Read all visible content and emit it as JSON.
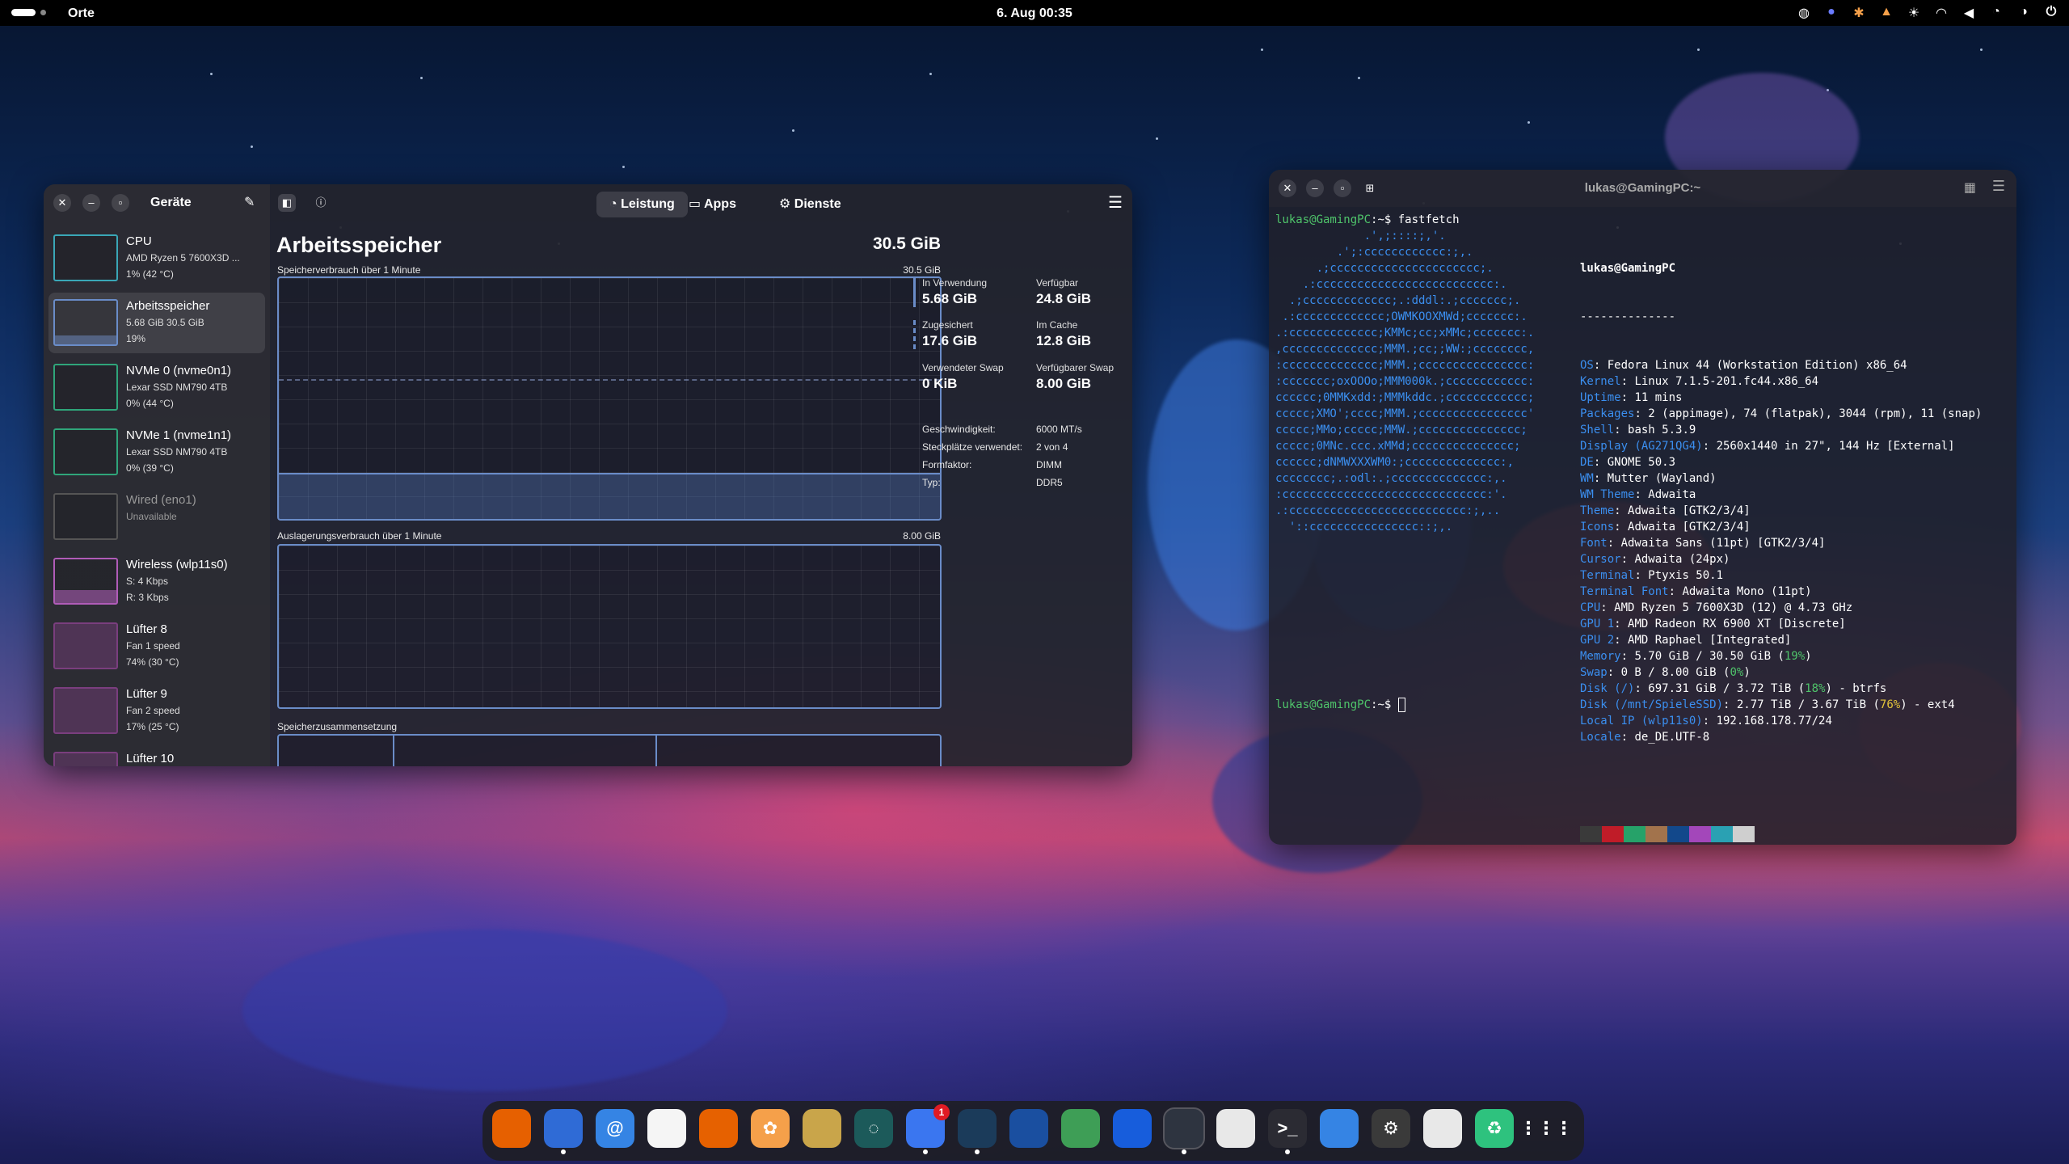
{
  "topbar": {
    "places_label": "Orte",
    "clock": "6. Aug  00:35",
    "tray_icons": [
      "steam-icon",
      "discord-icon",
      "star-icon",
      "update-icon",
      "brightness-icon",
      "wifi-icon",
      "volume-icon",
      "power-profile-icon",
      "battery-icon",
      "power-icon"
    ]
  },
  "resources": {
    "sidebar_title": "Geräte",
    "devices": [
      {
        "name": "CPU",
        "line1": "AMD Ryzen 5 7600X3D ...",
        "line2": "1% (42 °C)",
        "selected": false,
        "dim": false
      },
      {
        "name": "Arbeitsspeicher",
        "line1": "5.68 GiB 30.5 GiB",
        "line2": "19%",
        "selected": true,
        "dim": false
      },
      {
        "name": "NVMe 0 (nvme0n1)",
        "line1": "Lexar SSD NM790 4TB",
        "line2": "0% (44 °C)",
        "selected": false,
        "dim": false
      },
      {
        "name": "NVMe 1 (nvme1n1)",
        "line1": "Lexar SSD NM790 4TB",
        "line2": "0% (39 °C)",
        "selected": false,
        "dim": false
      },
      {
        "name": "Wired (eno1)",
        "line1": "Unavailable",
        "line2": "",
        "selected": false,
        "dim": true
      },
      {
        "name": "Wireless (wlp11s0)",
        "line1": "S: 4 Kbps",
        "line2": "R: 3 Kbps",
        "selected": false,
        "dim": false
      },
      {
        "name": "Lüfter 8",
        "line1": "Fan 1 speed",
        "line2": "74% (30 °C)",
        "selected": false,
        "dim": false
      },
      {
        "name": "Lüfter 9",
        "line1": "Fan 2 speed",
        "line2": "17% (25 °C)",
        "selected": false,
        "dim": false
      },
      {
        "name": "Lüfter 10",
        "line1": "",
        "line2": "",
        "selected": false,
        "dim": false
      }
    ],
    "tabs": [
      "Leistung",
      "Apps",
      "Dienste"
    ],
    "title": "Arbeitsspeicher",
    "total": "30.5 GiB",
    "chart1_label": "Speicherverbrauch über 1 Minute",
    "chart1_max": "30.5 GiB",
    "chart2_label": "Auslagerungsverbrauch über 1 Minute",
    "chart2_max": "8.00 GiB",
    "composition_label": "Speicherzusammensetzung",
    "stats": {
      "in_use_label": "In Verwendung",
      "in_use": "5.68 GiB",
      "available_label": "Verfügbar",
      "available": "24.8 GiB",
      "committed_label": "Zugesichert",
      "committed": "17.6 GiB",
      "cache_label": "Im Cache",
      "cache": "12.8 GiB",
      "swap_used_label": "Verwendeter Swap",
      "swap_used": "0 KiB",
      "swap_avail_label": "Verfügbarer Swap",
      "swap_avail": "8.00 GiB"
    },
    "props": {
      "speed_label": "Geschwindigkeit:",
      "speed": "6000 MT/s",
      "slots_label": "Steckplätze verwendet:",
      "slots": "2 von 4",
      "form_label": "Formfaktor:",
      "form": "DIMM",
      "type_label": "Typ:",
      "type": "DDR5"
    },
    "memory_usage_fraction": 0.19
  },
  "terminal": {
    "title": "lukas@GamingPC:~",
    "prompt": "lukas@GamingPC",
    "prompt_suffix": ":~$ ",
    "command": "fastfetch",
    "ascii": [
      "             .',;::::;,'.",
      "         .';:cccccccccccc:;,.",
      "      .;cccccccccccccccccccccc;.",
      "    .:cccccccccccccccccccccccccc:.",
      "  .;ccccccccccccc;.:dddl:.;ccccccc;.",
      " .:ccccccccccccc;OWMKOOXMWd;ccccccc:.",
      ".:ccccccccccccc;KMMc;cc;xMMc;ccccccc:.",
      ",cccccccccccccc;MMM.;cc;;WW:;cccccccc,",
      ":cccccccccccccc;MMM.;cccccccccccccccc:",
      ":ccccccc;oxOOOo;MMM000k.;cccccccccccc:",
      "cccccc;0MMKxdd:;MMMkddc.;cccccccccccc;",
      "ccccc;XMO';cccc;MMM.;cccccccccccccccc'",
      "ccccc;MMo;ccccc;MMW.;ccccccccccccccc;",
      "ccccc;0MNc.ccc.xMMd;ccccccccccccccc;",
      "cccccc;dNMWXXXWM0:;cccccccccccccc:,",
      "cccccccc;.:odl:.;cccccccccccccc:,.",
      ":cccccccccccccccccccccccccccccc:'.",
      ".:cccccccccccccccccccccccccc:;,..",
      "  '::cccccccccccccccc::;,."
    ],
    "user_host": "lukas@GamingPC",
    "separator": "--------------",
    "info": [
      {
        "key": "OS",
        "value": "Fedora Linux 44 (Workstation Edition) x86_64"
      },
      {
        "key": "Kernel",
        "value": "Linux 7.1.5-201.fc44.x86_64"
      },
      {
        "key": "Uptime",
        "value": "11 mins"
      },
      {
        "key": "Packages",
        "value": "2 (appimage), 74 (flatpak), 3044 (rpm), 11 (snap)"
      },
      {
        "key": "Shell",
        "value": "bash 5.3.9"
      },
      {
        "key": "Display (AG271QG4)",
        "value": "2560x1440 in 27\", 144 Hz [External]"
      },
      {
        "key": "DE",
        "value": "GNOME 50.3"
      },
      {
        "key": "WM",
        "value": "Mutter (Wayland)"
      },
      {
        "key": "WM Theme",
        "value": "Adwaita"
      },
      {
        "key": "Theme",
        "value": "Adwaita [GTK2/3/4]"
      },
      {
        "key": "Icons",
        "value": "Adwaita [GTK2/3/4]"
      },
      {
        "key": "Font",
        "value": "Adwaita Sans (11pt) [GTK2/3/4]"
      },
      {
        "key": "Cursor",
        "value": "Adwaita (24px)"
      },
      {
        "key": "Terminal",
        "value": "Ptyxis 50.1"
      },
      {
        "key": "Terminal Font",
        "value": "Adwaita Mono (11pt)"
      },
      {
        "key": "CPU",
        "value": "AMD Ryzen 5 7600X3D (12) @ 4.73 GHz"
      },
      {
        "key": "GPU 1",
        "value": "AMD Radeon RX 6900 XT [Discrete]"
      },
      {
        "key": "GPU 2",
        "value": "AMD Raphael [Integrated]"
      },
      {
        "key": "Memory",
        "value": "5.70 GiB / 30.50 GiB",
        "pct": "19%",
        "pct_color": "green"
      },
      {
        "key": "Swap",
        "value": "0 B / 8.00 GiB",
        "pct": "0%",
        "pct_color": "green"
      },
      {
        "key": "Disk (/)",
        "value": "697.31 GiB / 3.72 TiB",
        "pct": "18%",
        "pct_color": "green",
        "suffix": " - btrfs"
      },
      {
        "key": "Disk (/mnt/SpieleSSD)",
        "value": "2.77 TiB / 3.67 TiB",
        "pct": "76%",
        "pct_color": "yellow",
        "suffix": " - ext4"
      },
      {
        "key": "Local IP (wlp11s0)",
        "value": "192.168.178.77/24"
      },
      {
        "key": "Locale",
        "value": "de_DE.UTF-8"
      }
    ],
    "palette_top": [
      "#3a3a3a",
      "#c01c28",
      "#26a269",
      "#a2734c",
      "#12488b",
      "#a347ba",
      "#2aa1b3",
      "#cfcfcf"
    ],
    "palette_bottom": [
      "#5e5c64",
      "#f66151",
      "#33d17a",
      "#e9ad0c",
      "#2a7bde",
      "#c061cb",
      "#33c7de",
      "#ffffff"
    ]
  },
  "dock": {
    "icons": [
      {
        "name": "firefox-icon",
        "glyph": "",
        "color": "#e66000",
        "running": false
      },
      {
        "name": "thunderbird-icon",
        "glyph": "",
        "color": "#2f6bd6",
        "running": true
      },
      {
        "name": "mail-icon",
        "glyph": "@",
        "color": "#3584e4",
        "running": false
      },
      {
        "name": "calendar-icon",
        "glyph": "",
        "color": "#f5f5f5",
        "running": false
      },
      {
        "name": "photos-icon",
        "glyph": "",
        "color": "#e66100",
        "running": false
      },
      {
        "name": "flower-app-icon",
        "glyph": "✿",
        "color": "#f5a04a",
        "running": false
      },
      {
        "name": "podcasts-icon",
        "glyph": "",
        "color": "#c9a54a",
        "running": false
      },
      {
        "name": "gitg-icon",
        "glyph": "◌",
        "color": "#1c5a5a",
        "running": false
      },
      {
        "name": "signal-icon",
        "glyph": "",
        "color": "#3a76f0",
        "running": true,
        "badge": "1"
      },
      {
        "name": "steam-icon",
        "glyph": "",
        "color": "#1b3b5a",
        "running": true
      },
      {
        "name": "protonvpn-icon",
        "glyph": "",
        "color": "#1a4fa0",
        "running": false
      },
      {
        "name": "compass-app-icon",
        "glyph": "",
        "color": "#3e9e56",
        "running": false
      },
      {
        "name": "bitwarden-icon",
        "glyph": "",
        "color": "#175ddc",
        "running": false
      },
      {
        "name": "resources-icon",
        "glyph": "",
        "color": "#2e3440",
        "running": true
      },
      {
        "name": "software-icon",
        "glyph": "",
        "color": "#e8e8e8",
        "running": false
      },
      {
        "name": "terminal-icon",
        "glyph": ">_",
        "color": "#2b2b33",
        "running": true
      },
      {
        "name": "text-editor-icon",
        "glyph": "",
        "color": "#3584e4",
        "running": false
      },
      {
        "name": "settings-icon",
        "glyph": "⚙",
        "color": "#3a3a3a",
        "running": false
      },
      {
        "name": "files-icon",
        "glyph": "",
        "color": "#e8e8e8",
        "running": false
      },
      {
        "name": "trash-icon",
        "glyph": "♻",
        "color": "#2ec27e",
        "running": false
      },
      {
        "name": "app-grid-icon",
        "glyph": "⋮⋮⋮",
        "color": "transparent",
        "running": false
      }
    ]
  }
}
